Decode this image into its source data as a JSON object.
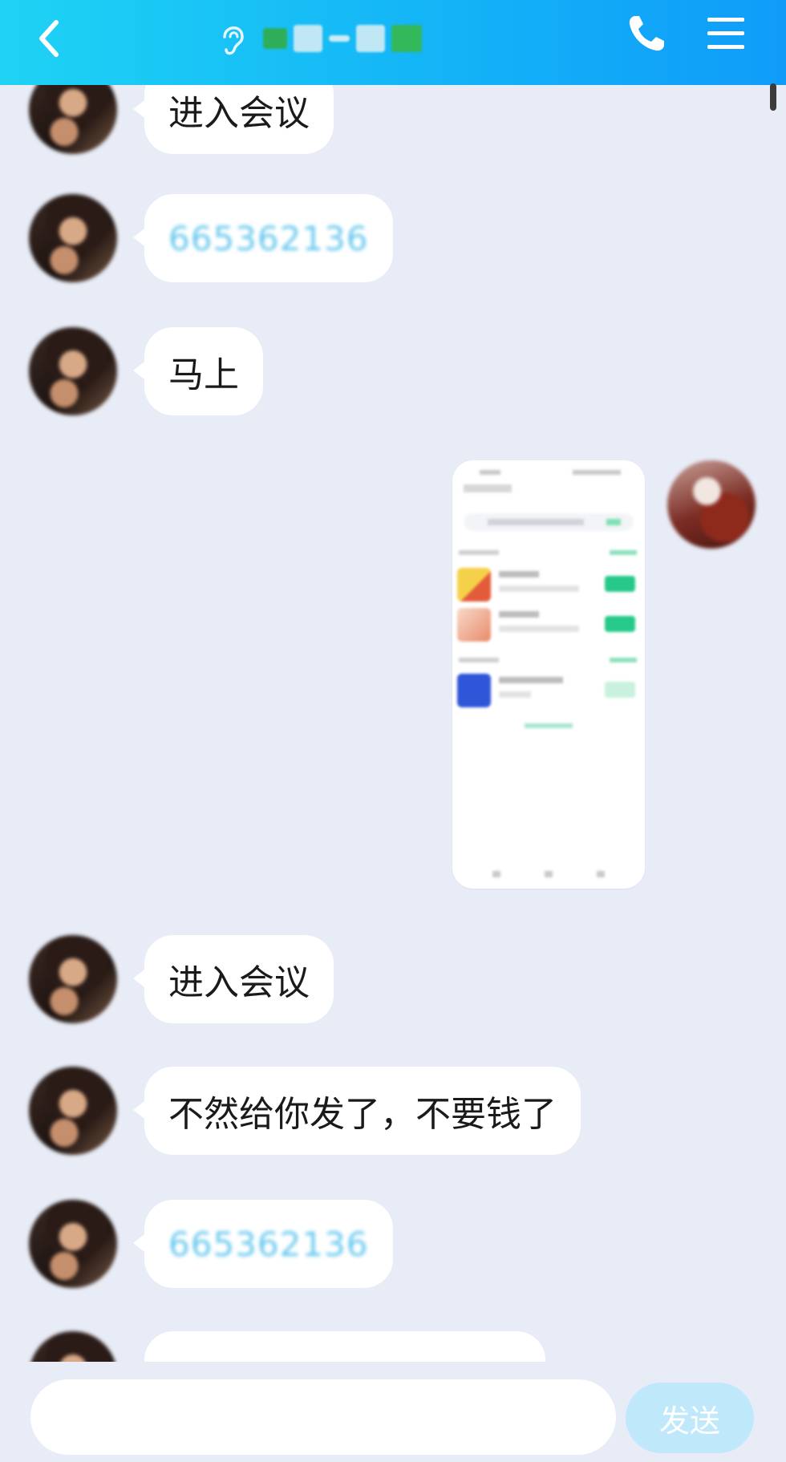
{
  "header": {
    "title": "",
    "accent_gradient": [
      "#1ed3f4",
      "#0f9cf9"
    ],
    "icons": [
      "chevron-left-icon",
      "ear-icon",
      "phone-icon",
      "menu-icon"
    ]
  },
  "messages": [
    {
      "side": "left",
      "type": "text",
      "text": "进入会议"
    },
    {
      "side": "left",
      "type": "link",
      "text": "665362136"
    },
    {
      "side": "left",
      "type": "text",
      "text": "马上"
    },
    {
      "side": "right",
      "type": "image",
      "text": ""
    },
    {
      "side": "left",
      "type": "text",
      "text": "进入会议"
    },
    {
      "side": "left",
      "type": "text",
      "text": "不然给你发了，不要钱了"
    },
    {
      "side": "left",
      "type": "link",
      "text": "665362136"
    },
    {
      "side": "left",
      "type": "text",
      "text": ""
    }
  ],
  "composer": {
    "input_value": "",
    "placeholder": "",
    "send_label": "发送",
    "send_color": "#bfe8fb"
  }
}
